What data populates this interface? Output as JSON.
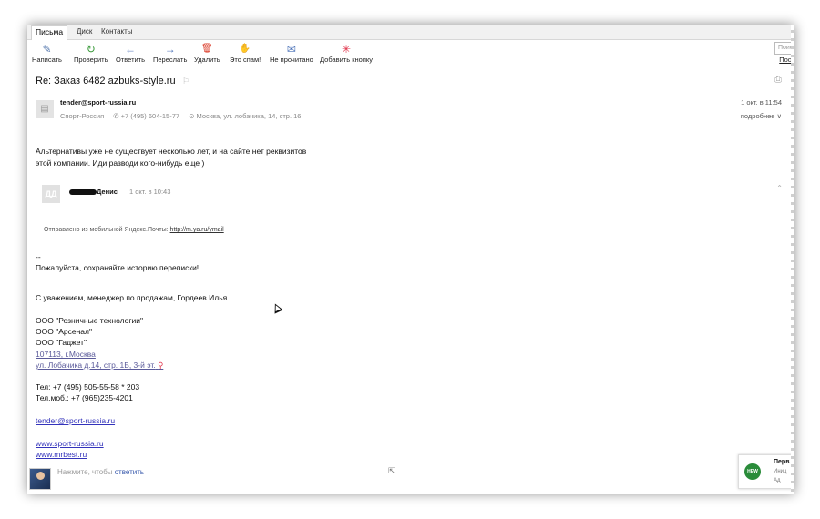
{
  "tabs": [
    {
      "label": "Письма"
    },
    {
      "label": "Диск"
    },
    {
      "label": "Контакты"
    }
  ],
  "toolbar": [
    {
      "label": "Написать",
      "icon": "compose-icon",
      "glyph": "✎",
      "color": "#5a7cb0"
    },
    {
      "label": "Проверить",
      "icon": "refresh-icon",
      "glyph": "↻",
      "color": "#3a9a3a"
    },
    {
      "label": "Ответить",
      "icon": "reply-icon",
      "glyph": "←",
      "color": "#4b72b8"
    },
    {
      "label": "Переслать",
      "icon": "forward-icon",
      "glyph": "→",
      "color": "#4b72b8"
    },
    {
      "label": "Удалить",
      "icon": "trash-icon",
      "glyph": "🗑",
      "color": "#d9331f"
    },
    {
      "label": "Это спам!",
      "icon": "spam-hand-icon",
      "glyph": "✋",
      "color": "#f2a400"
    },
    {
      "label": "Не прочитано",
      "icon": "envelope-icon",
      "glyph": "✉",
      "color": "#4b72b8"
    },
    {
      "label": "Добавить кнопку",
      "icon": "add-button-star-icon",
      "glyph": "✳",
      "color": "#e0334a"
    }
  ],
  "search": {
    "placeholder": "Поиск",
    "link": "Пост"
  },
  "message": {
    "subject": "Re: Заказ 6482 azbuks-style.ru",
    "sender_email": "tender@sport-russia.ru",
    "sender_org": "Спорт-Россия",
    "sender_phone": "✆ +7 (495) 604-15-77",
    "sender_address": "⊙ Москва, ул. лобачика, 14, стр. 16",
    "date": "1 окт. в 11:54",
    "details": "подробнее ∨",
    "body_line1": "Альтернативы уже не существует несколько лет, и на сайте нет реквизитов",
    "body_line2": "этой компании. Иди разводи кого-нибудь еще )",
    "quote": {
      "avatar_initials": "ДД",
      "author": "Денис",
      "date": "1 окт. в 10:43",
      "sent_text": "Отправлено из мобильной Яндекс.Почты:",
      "sent_link": "http://m.ya.ru/ymail"
    },
    "sig_dash": "--",
    "sig_keep": "Пожалуйста, сохраняйте историю переписки!",
    "sig_regards": "С уважением, менеджер по продажам, Гордеев Илья",
    "sig_company1": "ООО \"Розничные технологии\"",
    "sig_company2": "ООО \"Арсенал\"",
    "sig_company3": "ООО \"Гаджет\"",
    "sig_city": "107113, г.Москва",
    "sig_street": "ул. Лобачика д.14, стр. 1Б, 3-й эт.",
    "sig_tel": "Тел: +7 (495) 505-55-58 * 203",
    "sig_mobile": "Тел.моб.: +7 (965)235-4201",
    "sig_email": "tender@sport-russia.ru",
    "sig_site1": "www.sport-russia.ru",
    "sig_site2": "www.mrbest.ru"
  },
  "reply": {
    "placeholder": "Нажмите, чтобы",
    "action": "ответить"
  },
  "notification": {
    "badge": "НЕW",
    "title": "Перв",
    "text": "Иниц",
    "sub": "Ад"
  }
}
